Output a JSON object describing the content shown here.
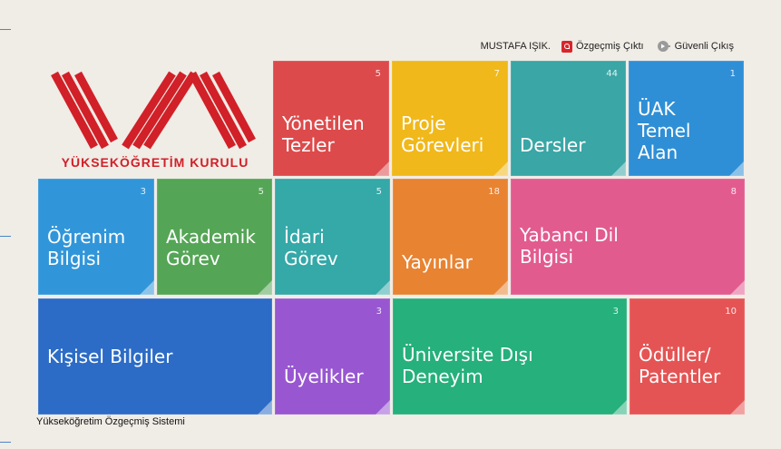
{
  "header": {
    "user_name": "MUSTAFA IŞIK.",
    "cv_output_label": "Özgeçmiş Çıktı",
    "logout_label": "Güvenli Çıkış"
  },
  "logo": {
    "text": "YÜKSEKÖĞRETİM KURULU",
    "color": "#d12028"
  },
  "tiles": {
    "thesis": {
      "label": "Yönetilen\nTezler",
      "count": "5",
      "color": "#dd4a4b"
    },
    "project": {
      "label": "Proje\nGörevleri",
      "count": "7",
      "color": "#f0b81a"
    },
    "courses": {
      "label": "Dersler",
      "count": "44",
      "color": "#3aa6a6"
    },
    "uak": {
      "label": "ÜAK\nTemel\nAlan",
      "count": "1",
      "color": "#2f8fd6"
    },
    "education": {
      "label": "Öğrenim\nBilgisi",
      "count": "3",
      "color": "#3196d9"
    },
    "academic": {
      "label": "Akademik\nGörev",
      "count": "5",
      "color": "#55a556"
    },
    "admin": {
      "label": "İdari\nGörev",
      "count": "5",
      "color": "#35a8a8"
    },
    "publications": {
      "label": "Yayınlar",
      "count": "18",
      "color": "#e88332"
    },
    "language": {
      "label": "Yabancı Dil\nBilgisi",
      "count": "8",
      "color": "#e25b8f"
    },
    "personal": {
      "label": "Kişisel Bilgiler",
      "count": "",
      "color": "#2c6cc7"
    },
    "memberships": {
      "label": "Üyelikler",
      "count": "3",
      "color": "#9857d1"
    },
    "nonuni": {
      "label": "Üniversite Dışı\nDeneyim",
      "count": "3",
      "color": "#25b07c"
    },
    "awards": {
      "label": "Ödüller/\nPatentler",
      "count": "10",
      "color": "#e55454"
    }
  },
  "footer": {
    "text": "Yükseköğretim Özgeçmiş Sistemi"
  }
}
